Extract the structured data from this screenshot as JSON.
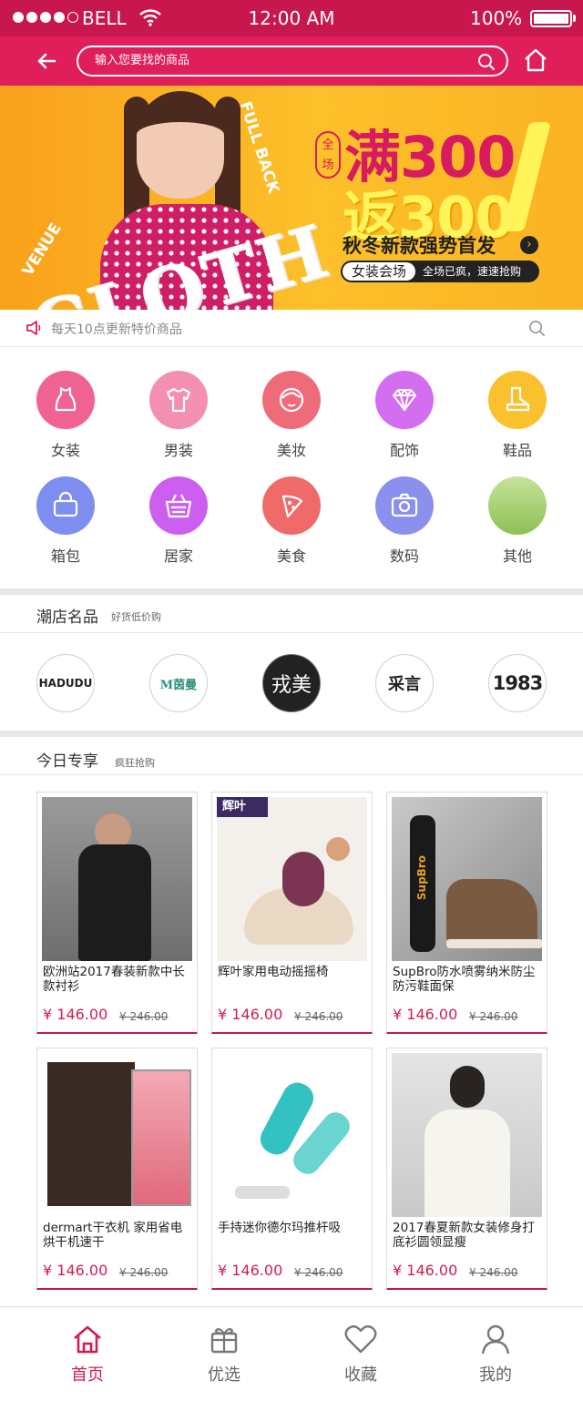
{
  "status_bar": {
    "carrier": "BELL",
    "time": "12:00 AM",
    "battery": "100%"
  },
  "nav": {
    "search_placeholder": "输入您要找的商品"
  },
  "banner": {
    "left_text": "CLOTH",
    "side_text_1": "VENUE",
    "side_text_2": "FULL BACK",
    "badge": "全场",
    "line1": "满300",
    "line2": "返300",
    "subtitle": "秋冬新款强势首发",
    "pill_tag": "女装会场",
    "pill_text": "全场已疯，速速抢购"
  },
  "notice": {
    "text": "每天10点更新特价商品"
  },
  "categories": [
    {
      "label": "女装",
      "color": "#f06292",
      "icon": "dress-icon"
    },
    {
      "label": "男装",
      "color": "#f48fb1",
      "icon": "shirt-icon"
    },
    {
      "label": "美妆",
      "color": "#ef6b7a",
      "icon": "face-icon"
    },
    {
      "label": "配饰",
      "color": "#d36ef0",
      "icon": "diamond-icon"
    },
    {
      "label": "鞋品",
      "color": "#fbc02d",
      "icon": "boot-icon"
    },
    {
      "label": "箱包",
      "color": "#7e8df0",
      "icon": "bag-icon"
    },
    {
      "label": "居家",
      "color": "#cc5ff0",
      "icon": "basket-icon"
    },
    {
      "label": "美食",
      "color": "#f06a6a",
      "icon": "pizza-icon"
    },
    {
      "label": "数码",
      "color": "#8b90ee",
      "icon": "camera-icon"
    },
    {
      "label": "其他",
      "color": "#a8d16f",
      "icon": "other-icon"
    }
  ],
  "shops": {
    "title": "潮店名品",
    "subtitle": "好货低价购",
    "brands": [
      {
        "name": "HADUDU",
        "icon": "brand-hadudu-logo"
      },
      {
        "name": "M茵曼",
        "icon": "brand-inman-logo"
      },
      {
        "name": "戎美",
        "icon": "brand-rongmei-logo"
      },
      {
        "name": "采言",
        "icon": "brand-caiyan-logo"
      },
      {
        "name": "1983",
        "icon": "brand-1983-logo"
      }
    ]
  },
  "today": {
    "title": "今日专享",
    "subtitle": "疯狂抢购",
    "products": [
      {
        "title": "欧洲站2017春装新款中长款衬衫",
        "price": "¥ 146.00",
        "old_price": "¥ 246.00"
      },
      {
        "title": "辉叶家用电动摇摇椅",
        "price": "¥ 146.00",
        "old_price": "¥ 246.00",
        "badge": "辉叶"
      },
      {
        "title": "SupBro防水喷雾纳米防尘防污鞋面保",
        "price": "¥ 146.00",
        "old_price": "¥ 246.00"
      },
      {
        "title": "dermart干衣机 家用省电烘干机速干",
        "price": "¥ 146.00",
        "old_price": "¥ 246.00"
      },
      {
        "title": "手持迷你德尔玛推杆吸",
        "price": "¥ 146.00",
        "old_price": "¥ 246.00"
      },
      {
        "title": "2017春夏新款女装修身打底衫圆领显瘦",
        "price": "¥ 146.00",
        "old_price": "¥ 246.00"
      }
    ]
  },
  "tabbar": [
    {
      "label": "首页",
      "active": true
    },
    {
      "label": "优选",
      "active": false
    },
    {
      "label": "收藏",
      "active": false
    },
    {
      "label": "我的",
      "active": false
    }
  ],
  "colors": {
    "brand": "#e01e5a",
    "status": "#c8174d",
    "price": "#d01e4f"
  }
}
